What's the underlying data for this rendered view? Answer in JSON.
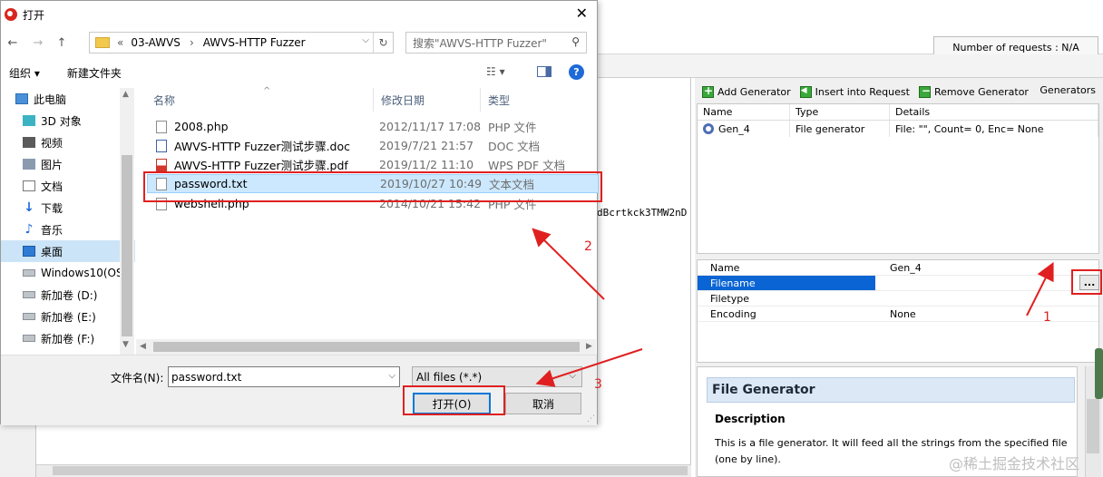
{
  "background_app": {
    "number_of_requests": "Number of requests : N/A",
    "mid_text_fragment": "dBcrtkck3TMW2nD",
    "toolbar": {
      "add_generator": "Add Generator",
      "insert_into_request": "Insert into Request",
      "remove_generator": "Remove Generator",
      "generators_title": "Generators"
    },
    "gen_table": {
      "headers": [
        "Name",
        "Type",
        "Details"
      ],
      "rows": [
        {
          "name": "Gen_4",
          "type": "File generator",
          "details": "File: \"\", Count= 0, Enc= None"
        }
      ]
    },
    "properties": [
      {
        "key": "Name",
        "value": "Gen_4"
      },
      {
        "key": "Filename",
        "value": ""
      },
      {
        "key": "Filetype",
        "value": ""
      },
      {
        "key": "Encoding",
        "value": "None"
      }
    ],
    "ellipsis_label": "...",
    "description": {
      "header": "File Generator",
      "subheader": "Description",
      "text": "This is a file generator. It will feed all the strings from the specified file (one by line)."
    },
    "watermark": "@稀土掘金技术社区"
  },
  "dialog": {
    "title": "打开",
    "close_glyph": "✕",
    "nav": {
      "back": "←",
      "forward": "→",
      "up": "↑"
    },
    "address": {
      "prefix": "«",
      "crumb1": "03-AWVS",
      "separator": "›",
      "crumb2": "AWVS-HTTP Fuzzer",
      "dropdown": "⌵",
      "refresh": "↻"
    },
    "search_placeholder": "搜索\"AWVS-HTTP Fuzzer\"",
    "search_glyph": "⚲",
    "commands": {
      "organize": "组织 ▾",
      "new_folder": "新建文件夹",
      "view_glyph": "☷ ▾",
      "help_glyph": "?"
    },
    "tree": [
      {
        "label": "此电脑",
        "icon": "pc-icon"
      },
      {
        "label": "3D 对象",
        "icon": "cube-icon"
      },
      {
        "label": "视频",
        "icon": "video-icon"
      },
      {
        "label": "图片",
        "icon": "picture-icon"
      },
      {
        "label": "文档",
        "icon": "document-icon"
      },
      {
        "label": "下载",
        "icon": "download-icon"
      },
      {
        "label": "音乐",
        "icon": "music-icon"
      },
      {
        "label": "桌面",
        "icon": "desktop-icon"
      },
      {
        "label": "Windows10(OS",
        "icon": "drive-icon"
      },
      {
        "label": "新加卷 (D:)",
        "icon": "drive-icon"
      },
      {
        "label": "新加卷 (E:)",
        "icon": "drive-icon"
      },
      {
        "label": "新加卷 (F:)",
        "icon": "drive-icon"
      }
    ],
    "columns": {
      "name": "名称",
      "modified": "修改日期",
      "type": "类型",
      "sort_glyph": "^"
    },
    "files": [
      {
        "name": "2008.php",
        "modified": "2012/11/17 17:08",
        "type": "PHP 文件",
        "icon": "file-icon"
      },
      {
        "name": "AWVS-HTTP Fuzzer测试步骤.doc",
        "modified": "2019/7/21 21:57",
        "type": "DOC 文档",
        "icon": "word-file-icon"
      },
      {
        "name": "AWVS-HTTP Fuzzer测试步骤.pdf",
        "modified": "2019/11/2 11:10",
        "type": "WPS PDF 文档",
        "icon": "pdf-file-icon"
      },
      {
        "name": "password.txt",
        "modified": "2019/10/27 10:49",
        "type": "文本文档",
        "icon": "text-file-icon"
      },
      {
        "name": "webshell.php",
        "modified": "2014/10/21 15:42",
        "type": "PHP 文件",
        "icon": "file-icon"
      }
    ],
    "selected_file_index": 3,
    "filename_label": "文件名(N):",
    "filename_value": "password.txt",
    "filetype_value": "All files (*.*)",
    "open_button": "打开(O)",
    "cancel_button": "取消"
  },
  "annotations": {
    "step1": "1",
    "step2": "2",
    "step3": "3",
    "color": "#e02020"
  },
  "colors": {
    "selection": "#cce8ff",
    "accent_blue": "#0078d7",
    "property_selected": "#0a64d4"
  }
}
